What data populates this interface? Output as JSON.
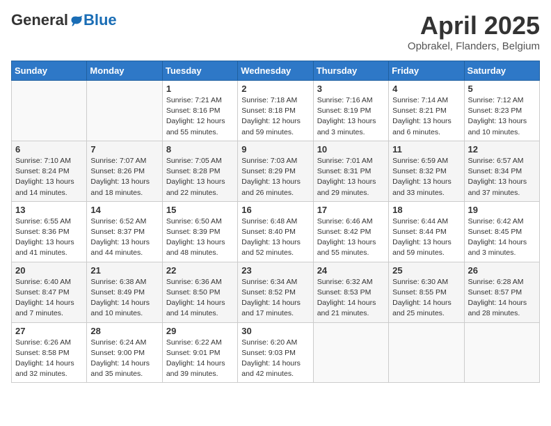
{
  "header": {
    "logo_general": "General",
    "logo_blue": "Blue",
    "month_title": "April 2025",
    "location": "Opbrakel, Flanders, Belgium"
  },
  "weekdays": [
    "Sunday",
    "Monday",
    "Tuesday",
    "Wednesday",
    "Thursday",
    "Friday",
    "Saturday"
  ],
  "weeks": [
    [
      {
        "day": "",
        "info": ""
      },
      {
        "day": "",
        "info": ""
      },
      {
        "day": "1",
        "info": "Sunrise: 7:21 AM\nSunset: 8:16 PM\nDaylight: 12 hours\nand 55 minutes."
      },
      {
        "day": "2",
        "info": "Sunrise: 7:18 AM\nSunset: 8:18 PM\nDaylight: 12 hours\nand 59 minutes."
      },
      {
        "day": "3",
        "info": "Sunrise: 7:16 AM\nSunset: 8:19 PM\nDaylight: 13 hours\nand 3 minutes."
      },
      {
        "day": "4",
        "info": "Sunrise: 7:14 AM\nSunset: 8:21 PM\nDaylight: 13 hours\nand 6 minutes."
      },
      {
        "day": "5",
        "info": "Sunrise: 7:12 AM\nSunset: 8:23 PM\nDaylight: 13 hours\nand 10 minutes."
      }
    ],
    [
      {
        "day": "6",
        "info": "Sunrise: 7:10 AM\nSunset: 8:24 PM\nDaylight: 13 hours\nand 14 minutes."
      },
      {
        "day": "7",
        "info": "Sunrise: 7:07 AM\nSunset: 8:26 PM\nDaylight: 13 hours\nand 18 minutes."
      },
      {
        "day": "8",
        "info": "Sunrise: 7:05 AM\nSunset: 8:28 PM\nDaylight: 13 hours\nand 22 minutes."
      },
      {
        "day": "9",
        "info": "Sunrise: 7:03 AM\nSunset: 8:29 PM\nDaylight: 13 hours\nand 26 minutes."
      },
      {
        "day": "10",
        "info": "Sunrise: 7:01 AM\nSunset: 8:31 PM\nDaylight: 13 hours\nand 29 minutes."
      },
      {
        "day": "11",
        "info": "Sunrise: 6:59 AM\nSunset: 8:32 PM\nDaylight: 13 hours\nand 33 minutes."
      },
      {
        "day": "12",
        "info": "Sunrise: 6:57 AM\nSunset: 8:34 PM\nDaylight: 13 hours\nand 37 minutes."
      }
    ],
    [
      {
        "day": "13",
        "info": "Sunrise: 6:55 AM\nSunset: 8:36 PM\nDaylight: 13 hours\nand 41 minutes."
      },
      {
        "day": "14",
        "info": "Sunrise: 6:52 AM\nSunset: 8:37 PM\nDaylight: 13 hours\nand 44 minutes."
      },
      {
        "day": "15",
        "info": "Sunrise: 6:50 AM\nSunset: 8:39 PM\nDaylight: 13 hours\nand 48 minutes."
      },
      {
        "day": "16",
        "info": "Sunrise: 6:48 AM\nSunset: 8:40 PM\nDaylight: 13 hours\nand 52 minutes."
      },
      {
        "day": "17",
        "info": "Sunrise: 6:46 AM\nSunset: 8:42 PM\nDaylight: 13 hours\nand 55 minutes."
      },
      {
        "day": "18",
        "info": "Sunrise: 6:44 AM\nSunset: 8:44 PM\nDaylight: 13 hours\nand 59 minutes."
      },
      {
        "day": "19",
        "info": "Sunrise: 6:42 AM\nSunset: 8:45 PM\nDaylight: 14 hours\nand 3 minutes."
      }
    ],
    [
      {
        "day": "20",
        "info": "Sunrise: 6:40 AM\nSunset: 8:47 PM\nDaylight: 14 hours\nand 7 minutes."
      },
      {
        "day": "21",
        "info": "Sunrise: 6:38 AM\nSunset: 8:49 PM\nDaylight: 14 hours\nand 10 minutes."
      },
      {
        "day": "22",
        "info": "Sunrise: 6:36 AM\nSunset: 8:50 PM\nDaylight: 14 hours\nand 14 minutes."
      },
      {
        "day": "23",
        "info": "Sunrise: 6:34 AM\nSunset: 8:52 PM\nDaylight: 14 hours\nand 17 minutes."
      },
      {
        "day": "24",
        "info": "Sunrise: 6:32 AM\nSunset: 8:53 PM\nDaylight: 14 hours\nand 21 minutes."
      },
      {
        "day": "25",
        "info": "Sunrise: 6:30 AM\nSunset: 8:55 PM\nDaylight: 14 hours\nand 25 minutes."
      },
      {
        "day": "26",
        "info": "Sunrise: 6:28 AM\nSunset: 8:57 PM\nDaylight: 14 hours\nand 28 minutes."
      }
    ],
    [
      {
        "day": "27",
        "info": "Sunrise: 6:26 AM\nSunset: 8:58 PM\nDaylight: 14 hours\nand 32 minutes."
      },
      {
        "day": "28",
        "info": "Sunrise: 6:24 AM\nSunset: 9:00 PM\nDaylight: 14 hours\nand 35 minutes."
      },
      {
        "day": "29",
        "info": "Sunrise: 6:22 AM\nSunset: 9:01 PM\nDaylight: 14 hours\nand 39 minutes."
      },
      {
        "day": "30",
        "info": "Sunrise: 6:20 AM\nSunset: 9:03 PM\nDaylight: 14 hours\nand 42 minutes."
      },
      {
        "day": "",
        "info": ""
      },
      {
        "day": "",
        "info": ""
      },
      {
        "day": "",
        "info": ""
      }
    ]
  ]
}
